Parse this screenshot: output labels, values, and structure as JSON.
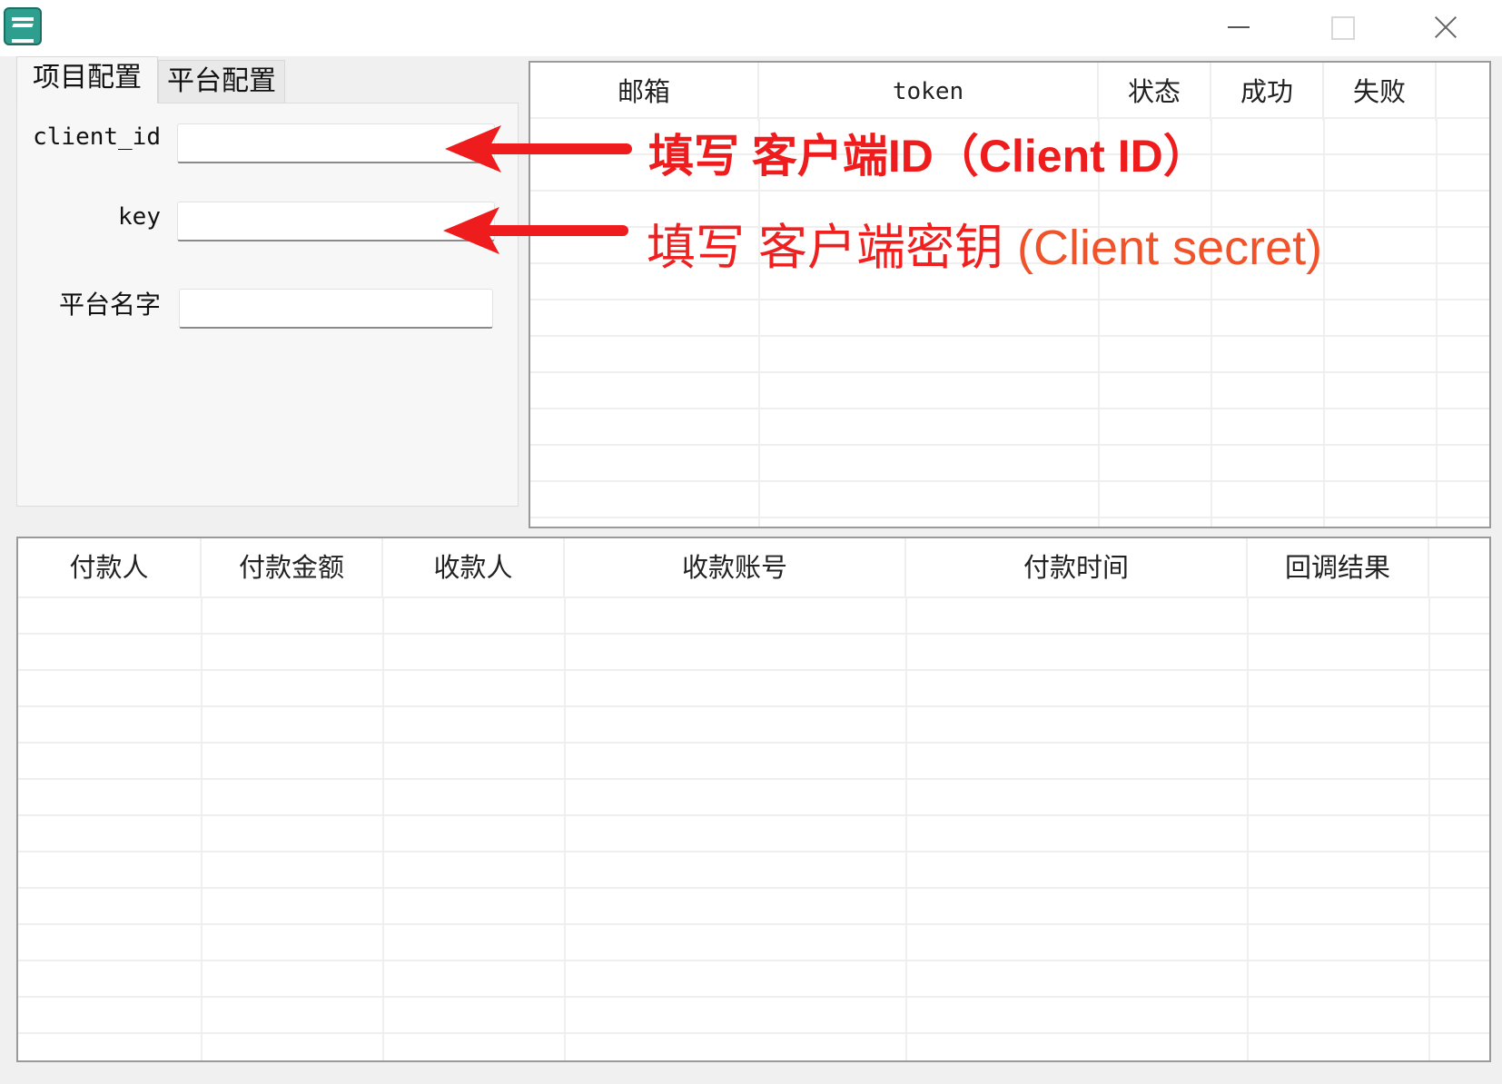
{
  "window": {
    "icon": "app-logo-icon",
    "controls": [
      "minimize-icon",
      "maximize-icon",
      "close-icon"
    ]
  },
  "tabs": [
    {
      "label": "项目配置",
      "active": true
    },
    {
      "label": "平台配置",
      "active": false
    }
  ],
  "config": {
    "client_id_label": "client_id",
    "key_label": "key",
    "platform_name_label": "平台名字",
    "client_id_value": "",
    "key_value": "",
    "platform_name_value": ""
  },
  "accounts_table": {
    "columns": [
      "邮箱",
      "token",
      "状态",
      "成功",
      "失败"
    ],
    "rows": []
  },
  "payments_table": {
    "columns": [
      "付款人",
      "付款金额",
      "收款人",
      "收款账号",
      "付款时间",
      "回调结果"
    ],
    "rows": []
  },
  "annotations": {
    "client_id_note_cn": "填写 客户端ID",
    "client_id_note_en": "（Client ID）",
    "key_note_cn": "填写 客户端密钥",
    "key_note_en": "(Client secret)",
    "color": "#ee1c1c"
  }
}
